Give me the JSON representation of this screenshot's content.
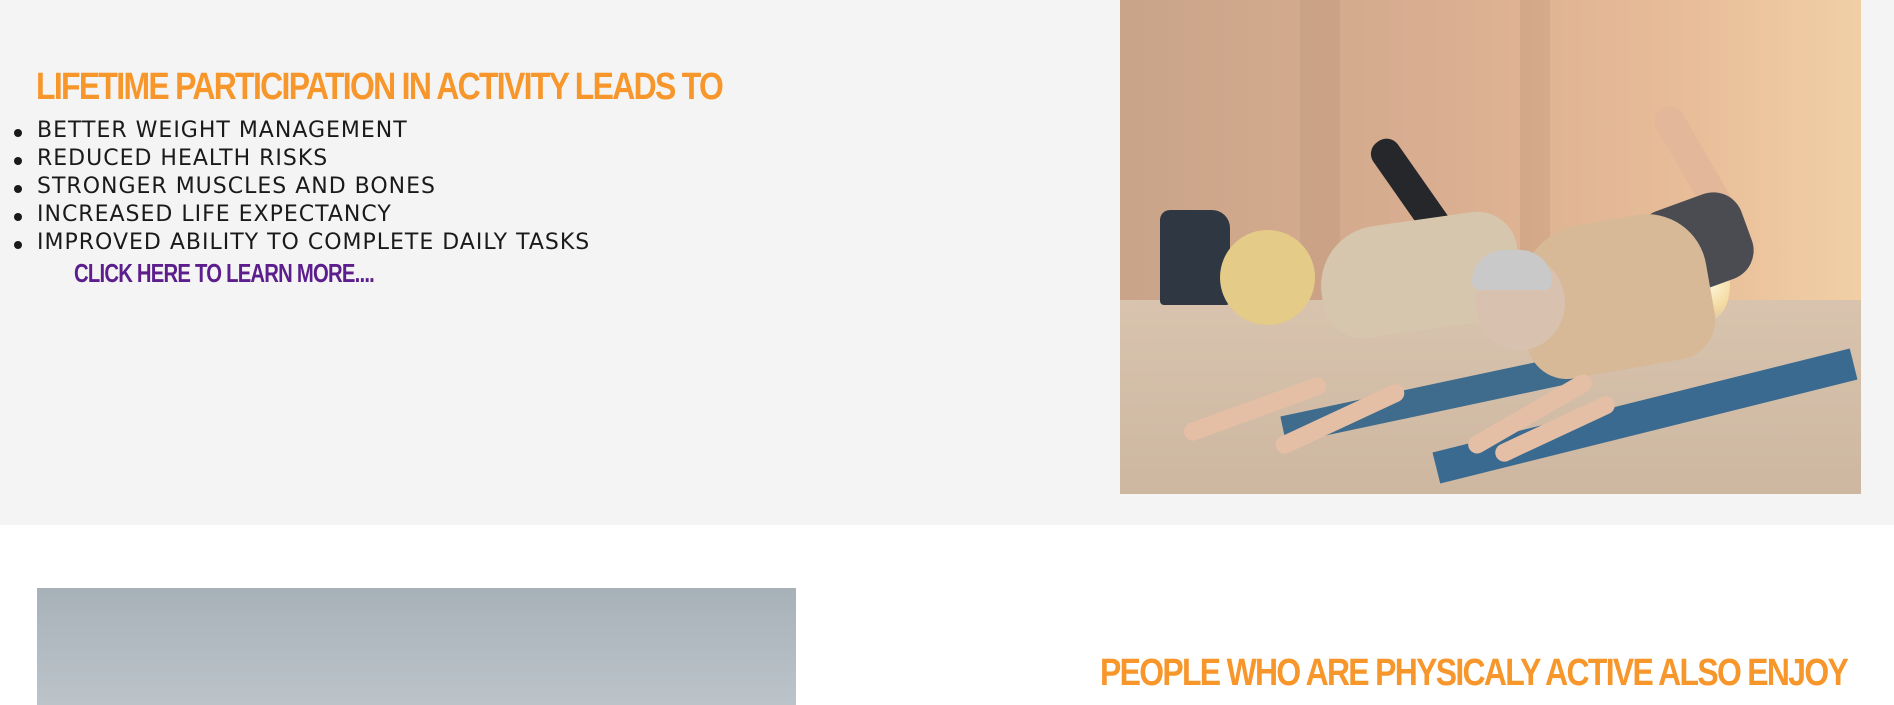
{
  "section_top": {
    "heading": "LIFETIME PARTICIPATION IN ACTIVITY LEADS TO",
    "benefits": [
      "BETTER WEIGHT MANAGEMENT",
      "REDUCED HEALTH RISKS",
      "STRONGER MUSCLES AND BONES",
      "INCREASED LIFE EXPECTANCY",
      "IMPROVED ABILITY TO COMPLETE DAILY TASKS"
    ],
    "learn_more_label": "CLICK HERE TO LEARN MORE....",
    "photo_alt": "Two older adults exercising on yoga mats"
  },
  "section_bottom": {
    "heading": "PEOPLE WHO ARE PHYSICALY ACTIVE ALSO ENJOY",
    "photo_alt": "Photo"
  },
  "colors": {
    "heading_orange": "#f7962b",
    "link_purple": "#5b1e8c",
    "section_bg": "#f4f4f4"
  }
}
